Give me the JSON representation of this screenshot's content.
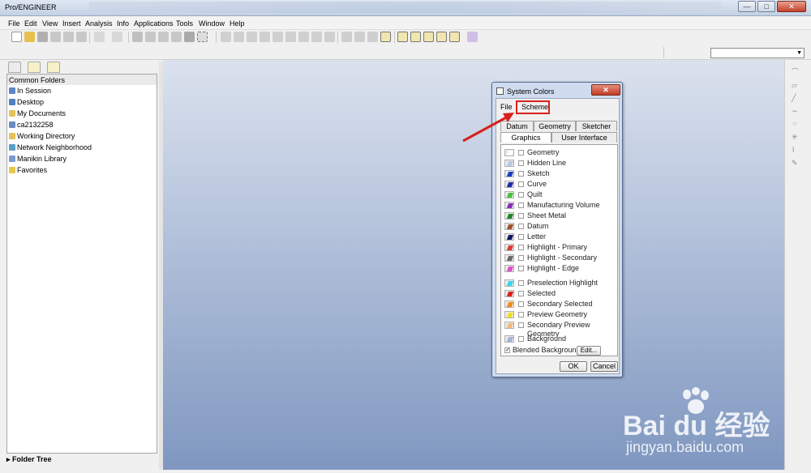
{
  "window": {
    "title": "Pro/ENGINEER",
    "min": "—",
    "max": "□",
    "close": "✕"
  },
  "menu": [
    "File",
    "Edit",
    "View",
    "Insert",
    "Analysis",
    "Info",
    "Applications",
    "Tools",
    "Window",
    "Help"
  ],
  "navigator": {
    "header": "Common Folders",
    "items": [
      "In Session",
      "Desktop",
      "My Documents",
      "ca2132258",
      "Working Directory",
      "Network Neighborhood",
      "Manikin Library",
      "Favorites"
    ],
    "footer": "Folder Tree"
  },
  "dialog": {
    "title": "System Colors",
    "close_label": "✕",
    "menu_file": "File",
    "menu_scheme": "Scheme",
    "tabs_top": [
      "Datum",
      "Geometry",
      "Sketcher"
    ],
    "tabs_bottom": [
      "Graphics",
      "User Interface"
    ],
    "active_tab": "Graphics",
    "color_items": [
      {
        "label": "Geometry",
        "color": "#ffffff"
      },
      {
        "label": "Hidden Line",
        "color": "#b8c8e8"
      },
      {
        "label": "Sketch",
        "color": "#1c3fc7"
      },
      {
        "label": "Curve",
        "color": "#1a2fa8"
      },
      {
        "label": "Quilt",
        "color": "#48c23c"
      },
      {
        "label": "Manufacturing Volume",
        "color": "#8a2bb8"
      },
      {
        "label": "Sheet Metal",
        "color": "#1d8a2a"
      },
      {
        "label": "Datum",
        "color": "#a0522d"
      },
      {
        "label": "Letter",
        "color": "#0d1a66"
      },
      {
        "label": "Highlight - Primary",
        "color": "#d83a3a"
      },
      {
        "label": "Highlight - Secondary",
        "color": "#6a6a6a"
      },
      {
        "label": "Highlight - Edge",
        "color": "#e050c8"
      },
      {
        "label": "Preselection Highlight",
        "color": "#32d8e8"
      },
      {
        "label": "Selected",
        "color": "#e02020"
      },
      {
        "label": "Secondary Selected",
        "color": "#f08a1a"
      },
      {
        "label": "Preview Geometry",
        "color": "#f0e020"
      },
      {
        "label": "Secondary Preview Geometry",
        "color": "#f5b878"
      },
      {
        "label": "Background",
        "color": "#9fb4d8"
      }
    ],
    "blended_background": {
      "label": "Blended Background",
      "checked": true,
      "check_mark": "✓"
    },
    "edit_button": "Edit...",
    "ok_button": "OK",
    "cancel_button": "Cancel"
  },
  "watermark": {
    "brand": "Bai du 经验",
    "url": "jingyan.baidu.com"
  },
  "colors": {
    "highlight_box": "#d8211c",
    "canvas_top": "#dbe2ee",
    "canvas_bottom": "#7f97c0"
  }
}
